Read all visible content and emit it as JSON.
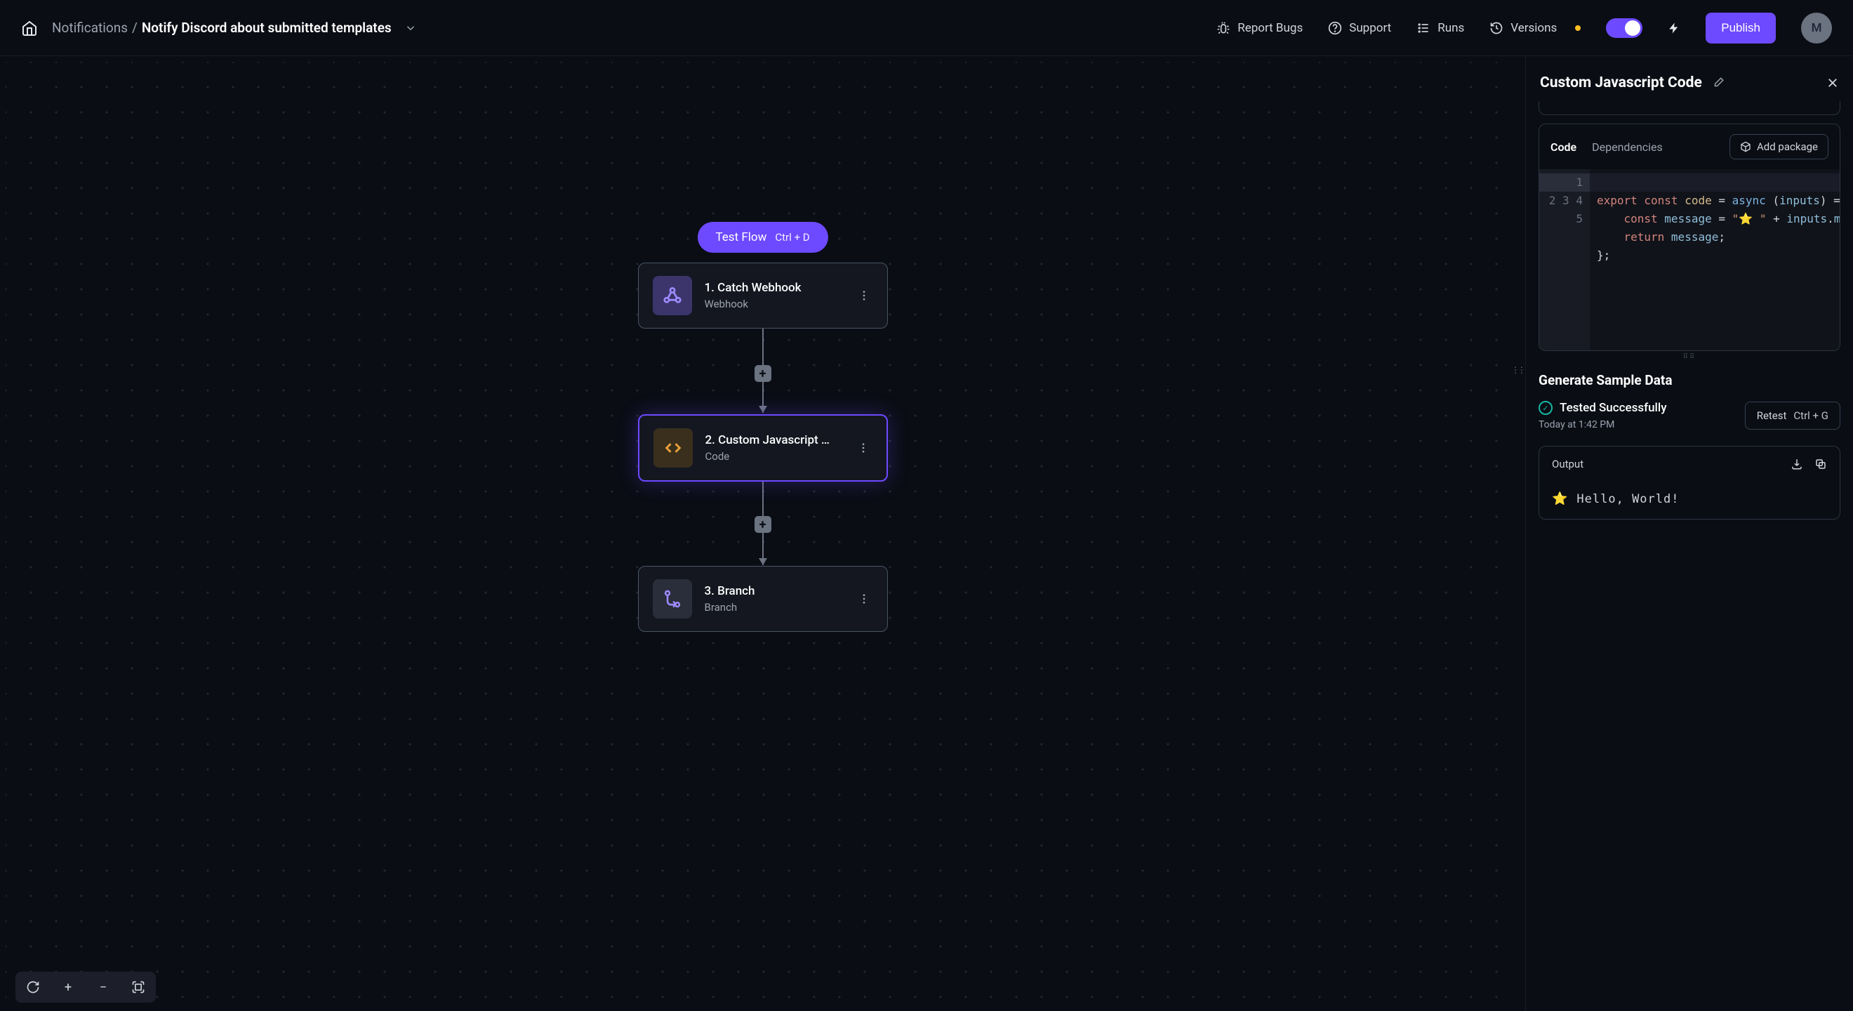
{
  "header": {
    "breadcrumb_parent": "Notifications",
    "breadcrumb_sep": "/",
    "breadcrumb_current": "Notify Discord about submitted templates",
    "links": {
      "report_bugs": "Report Bugs",
      "support": "Support",
      "runs": "Runs",
      "versions": "Versions"
    },
    "publish_label": "Publish",
    "avatar_initial": "M"
  },
  "canvas": {
    "test_flow_label": "Test Flow",
    "test_flow_kbd": "Ctrl + D",
    "nodes": [
      {
        "title": "1. Catch Webhook",
        "subtitle": "Webhook"
      },
      {
        "title": "2. Custom Javascript …",
        "subtitle": "Code"
      },
      {
        "title": "3. Branch",
        "subtitle": "Branch"
      }
    ]
  },
  "panel": {
    "title": "Custom Javascript Code",
    "tabs": {
      "code": "Code",
      "deps": "Dependencies"
    },
    "add_package_label": "Add package",
    "code": {
      "line_numbers": [
        "1",
        "2",
        "3",
        "4",
        "5"
      ],
      "tokens": {
        "export": "export",
        "const": "const",
        "code": "code",
        "eq": " = ",
        "async": "async",
        "paren_open": " (",
        "inputs": "inputs",
        "paren_close": ")",
        "arrow": " => {",
        "const2": "const",
        "message": "message",
        "eq2": " = ",
        "str_open": "\"⭐ \"",
        "plus": " + ",
        "inputs2": "inputs",
        "dot": ".",
        "msg": "message",
        "return": "return",
        "message2": "message",
        "semi": ";",
        "closebrace": "};"
      }
    },
    "sample": {
      "title": "Generate Sample Data",
      "status": "Tested Successfully",
      "time": "Today at 1:42 PM",
      "retest_label": "Retest",
      "retest_kbd": "Ctrl + G",
      "output_label": "Output",
      "output_star": "⭐",
      "output_text": "Hello, World!"
    }
  }
}
